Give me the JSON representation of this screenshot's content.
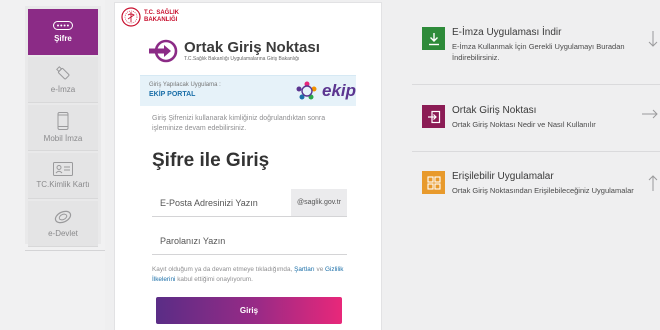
{
  "sidebar": {
    "items": [
      {
        "label": "Şifre",
        "icon": "password-dots-icon",
        "active": true
      },
      {
        "label": "e-İmza",
        "icon": "usb-token-icon",
        "active": false
      },
      {
        "label": "Mobil İmza",
        "icon": "mobile-phone-icon",
        "active": false
      },
      {
        "label": "TC.Kimlik Kartı",
        "icon": "id-card-icon",
        "active": false
      },
      {
        "label": "e-Devlet",
        "icon": "e-devlet-icon",
        "active": false
      }
    ]
  },
  "header": {
    "ministry_line1": "T.C. SAĞLIK",
    "ministry_line2": "BAKANLIĞI",
    "brand_title": "Ortak Giriş Noktası",
    "brand_subtitle": "T.C.Sağlık Bakanlığı Uygulamalarına Giriş Bakanlığı"
  },
  "app_box": {
    "caption": "Giriş Yapılacak Uygulama :",
    "app_name": "EKİP PORTAL",
    "logo_text": "ekip"
  },
  "form": {
    "info_text": "Giriş Şifrenizi kullanarak kimliğiniz doğrulandıktan sonra işleminize devam edebilirsiniz.",
    "title": "Şifre ile Giriş",
    "email_placeholder": "E-Posta Adresinizi Yazın",
    "email_value": "",
    "email_domain": "@saglik.gov.tr",
    "password_placeholder": "Parolanızı Yazın",
    "password_value": "",
    "consent_prefix": "Kayıt olduğum ya da devam etmeye tıkladığımda,",
    "consent_terms": "Şartları",
    "consent_and": "ve",
    "consent_privacy": "Gizlilik İlkelerini",
    "consent_suffix": "kabul ettiğimi onaylıyorum.",
    "login_label": "Giriş"
  },
  "links": [
    {
      "title": "E-İmza Uygulaması İndir",
      "description": "E-İmza Kullanmak İçin Gerekli Uygulamayı Buradan İndirebilirsiniz.",
      "icon": "download-icon",
      "arrow": "arrow-down-icon",
      "color": "#2e8b3a"
    },
    {
      "title": "Ortak Giriş Noktası",
      "description": "Ortak Giriş Noktası Nedir ve Nasıl Kullanılır",
      "icon": "login-icon",
      "arrow": "arrow-right-icon",
      "color": "#8b1c55"
    },
    {
      "title": "Erişilebilir Uygulamalar",
      "description": "Ortak Giriş Noktasından Erişilebileceğiniz Uygulamalar",
      "icon": "grid-apps-icon",
      "arrow": "arrow-up-icon",
      "color": "#e89a2c"
    }
  ],
  "colors": {
    "active_sidebar": "#8b2b86",
    "button_gradient_start": "#5a2d86",
    "button_gradient_end": "#e8287a",
    "link_blue": "#1b6fa8"
  }
}
